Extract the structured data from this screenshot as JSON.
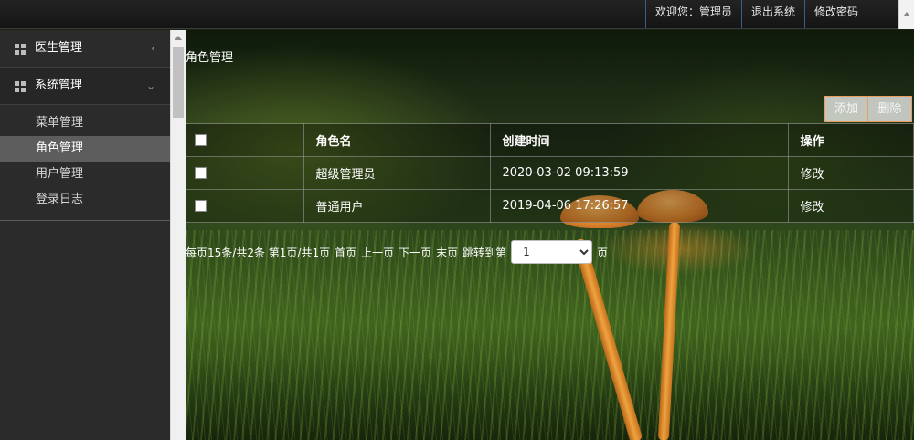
{
  "header": {
    "welcome": "欢迎您：管理员",
    "logout": "退出系统",
    "change_password": "修改密码"
  },
  "sidebar": {
    "groups": [
      {
        "label": "医生管理",
        "icon": "grid-icon",
        "caret": "‹",
        "expanded": false
      },
      {
        "label": "系统管理",
        "icon": "grid-icon",
        "caret": "⌄",
        "expanded": true,
        "items": [
          {
            "label": "菜单管理",
            "active": false
          },
          {
            "label": "角色管理",
            "active": true
          },
          {
            "label": "用户管理",
            "active": false
          },
          {
            "label": "登录日志",
            "active": false
          }
        ]
      }
    ]
  },
  "main": {
    "title": "角色管理",
    "toolbar": {
      "add_label": "添加",
      "delete_label": "删除"
    },
    "table": {
      "columns": [
        "",
        "角色名",
        "创建时间",
        "操作"
      ],
      "rows": [
        {
          "name": "超级管理员",
          "created": "2020-03-02 09:13:59",
          "action": "修改"
        },
        {
          "name": "普通用户",
          "created": "2019-04-06 17:26:57",
          "action": "修改"
        }
      ]
    },
    "pager": {
      "info": "每页15条/共2条 第1页/共1页",
      "first": "首页",
      "prev": "上一页",
      "next": "下一页",
      "last": "末页",
      "jump_prefix": "跳转到第",
      "page_value": "1",
      "jump_suffix": "页"
    }
  },
  "colors": {
    "accent_border": "#e8a060",
    "sidebar_bg": "#2b2b2b",
    "active_item_bg": "#5d5d5d",
    "header_link_border": "#3b5d8a"
  }
}
